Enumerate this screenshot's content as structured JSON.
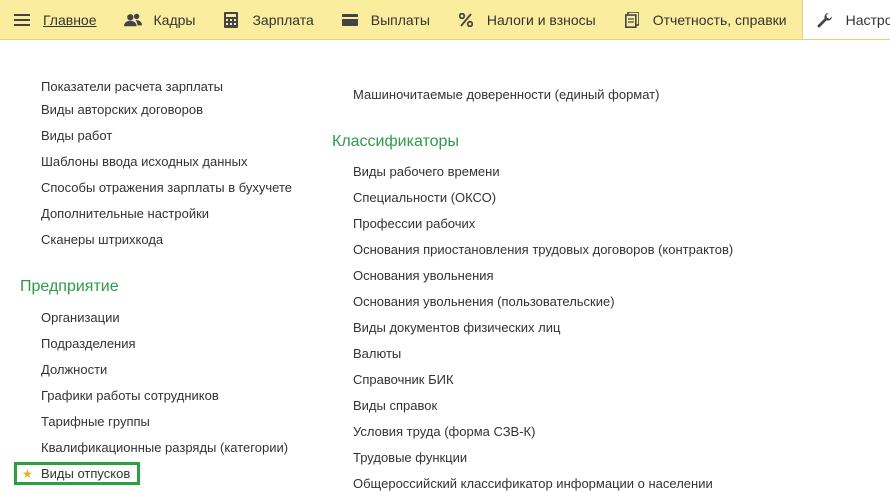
{
  "topbar": {
    "tabs": [
      {
        "label": "Главное",
        "icon": "hamburger-icon"
      },
      {
        "label": "Кадры",
        "icon": "users-icon"
      },
      {
        "label": "Зарплата",
        "icon": "calculator-icon"
      },
      {
        "label": "Выплаты",
        "icon": "wallet-icon"
      },
      {
        "label": "Налоги и взносы",
        "icon": "percent-icon"
      },
      {
        "label": "Отчетность, справки",
        "icon": "documents-icon"
      },
      {
        "label": "Настройка",
        "icon": "wrench-icon"
      }
    ],
    "active_tab": "Настройка"
  },
  "left_column": {
    "top_items": [
      "Показатели расчета зарплаты",
      "Виды авторских договоров",
      "Виды работ",
      "Шаблоны ввода исходных данных",
      "Способы отражения зарплаты в бухучете",
      "Дополнительные настройки",
      "Сканеры штрихкода"
    ],
    "section_title": "Предприятие",
    "section_items": [
      "Организации",
      "Подразделения",
      "Должности",
      "Графики работы сотрудников",
      "Тарифные группы",
      "Квалификационные разряды (категории)"
    ],
    "favorite_item": "Виды отпусков"
  },
  "right_column": {
    "top_item": "Машиночитаемые доверенности (единый формат)",
    "section_title": "Классификаторы",
    "section_items": [
      "Виды рабочего времени",
      "Специальности (ОКСО)",
      "Профессии рабочих",
      "Основания приостановления трудовых договоров (контрактов)",
      "Основания увольнения",
      "Основания увольнения (пользовательские)",
      "Виды документов физических лиц",
      "Валюты",
      "Справочник БИК",
      "Виды справок",
      "Условия труда (форма СЗВ-К)",
      "Трудовые функции",
      "Общероссийский классификатор информации о населении"
    ]
  },
  "colors": {
    "menu_bar": "#fbed9e",
    "section_title": "#2e9b48",
    "highlight_box": "#2aa043",
    "favorite_star": "#f0a81c"
  }
}
